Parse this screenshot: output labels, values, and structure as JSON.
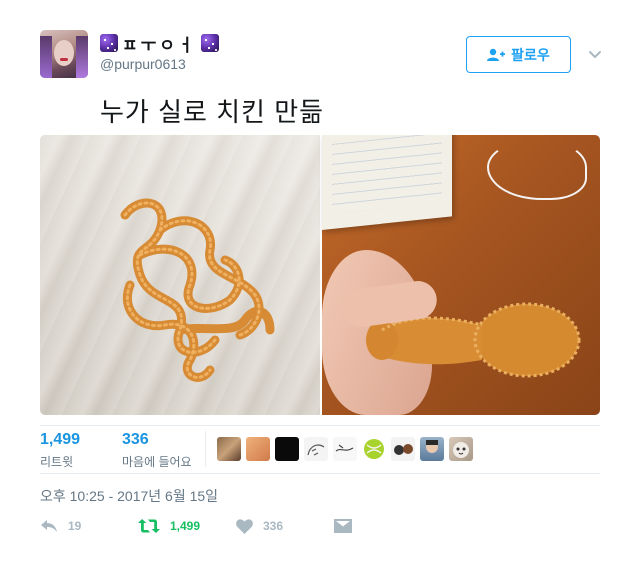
{
  "header": {
    "display_name": "ㅍㅜㅇㅓ",
    "handle": "@purpur0613",
    "follow_label": "팔로우"
  },
  "tweet": {
    "text": "누가 실로 치킨 만듦"
  },
  "stats": {
    "retweets": {
      "count": "1,499",
      "label": "리트윗"
    },
    "likes": {
      "count": "336",
      "label": "마음에 들어요"
    }
  },
  "timestamp": "오후 10:25 - 2017년 6월 15일",
  "actions": {
    "reply_count": "19",
    "retweet_count": "1,499",
    "like_count": "336"
  },
  "colors": {
    "accent": "#1da1f2",
    "retweet_active": "#17bf63",
    "muted": "#aab8c2"
  }
}
